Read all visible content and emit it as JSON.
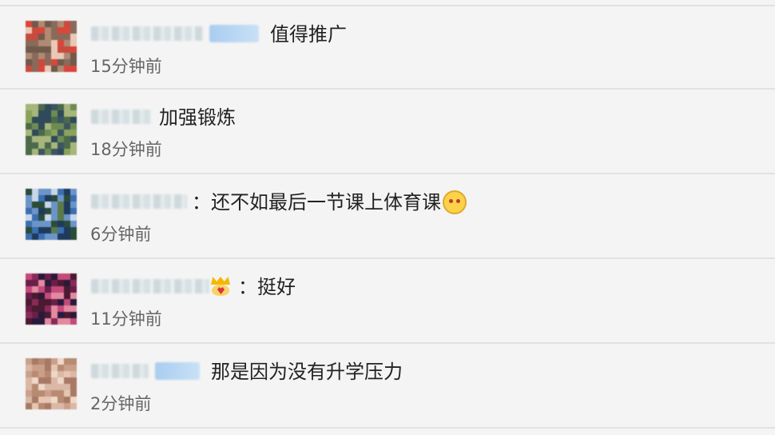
{
  "comments": [
    {
      "text": "值得推广",
      "time": "15分钟前",
      "emoji": null,
      "palette": [
        "#8a6a5a",
        "#c94a3e",
        "#e8c9b6",
        "#6f5a4c",
        "#d9463a",
        "#b08a72"
      ]
    },
    {
      "text": "加强锻炼",
      "time": "18分钟前",
      "emoji": null,
      "palette": [
        "#4c6a4a",
        "#8aa35a",
        "#2f4a5a",
        "#a7b67a",
        "#6d8c55",
        "#3c5560"
      ]
    },
    {
      "text": "：还不如最后一节课上体育课",
      "time": "6分钟前",
      "emoji": "smug-cat-emoji-icon",
      "palette": [
        "#3b6fb0",
        "#6b95c8",
        "#2a4c38",
        "#5a7a4a",
        "#c7d6e8",
        "#1e3a5c"
      ]
    },
    {
      "text": "：挺好",
      "time": "11分钟前",
      "emoji": "crown-emoji-icon",
      "palette": [
        "#6a1e48",
        "#c34a7a",
        "#2a1a3a",
        "#e38aa0",
        "#8a2a5a",
        "#4a1a30"
      ]
    },
    {
      "text": "那是因为没有升学压力",
      "time": "2分钟前",
      "emoji": null,
      "palette": [
        "#d9b8a6",
        "#caa08a",
        "#efd8c8",
        "#b88a72",
        "#e6c6b2",
        "#a87a66"
      ]
    }
  ]
}
